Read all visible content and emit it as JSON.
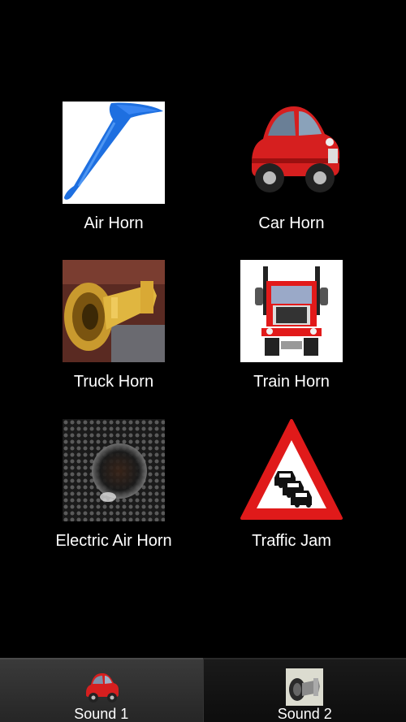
{
  "grid": {
    "items": [
      {
        "label": "Air Horn",
        "icon": "air-horn-icon"
      },
      {
        "label": "Car Horn",
        "icon": "red-car-icon"
      },
      {
        "label": "Truck Horn",
        "icon": "brass-truck-horn-icon"
      },
      {
        "label": "Train Horn",
        "icon": "truck-front-icon"
      },
      {
        "label": "Electric Air Horn",
        "icon": "speaker-grille-icon"
      },
      {
        "label": "Traffic Jam",
        "icon": "traffic-jam-sign-icon"
      }
    ]
  },
  "tabs": [
    {
      "label": "Sound 1",
      "icon": "red-car-icon",
      "active": true
    },
    {
      "label": "Sound 2",
      "icon": "horn-icon",
      "active": false
    }
  ],
  "colors": {
    "background": "#000000",
    "text": "#ffffff",
    "air_horn_blue": "#1e6fe0",
    "car_red": "#d61f1f",
    "sign_red": "#e01a1a"
  }
}
